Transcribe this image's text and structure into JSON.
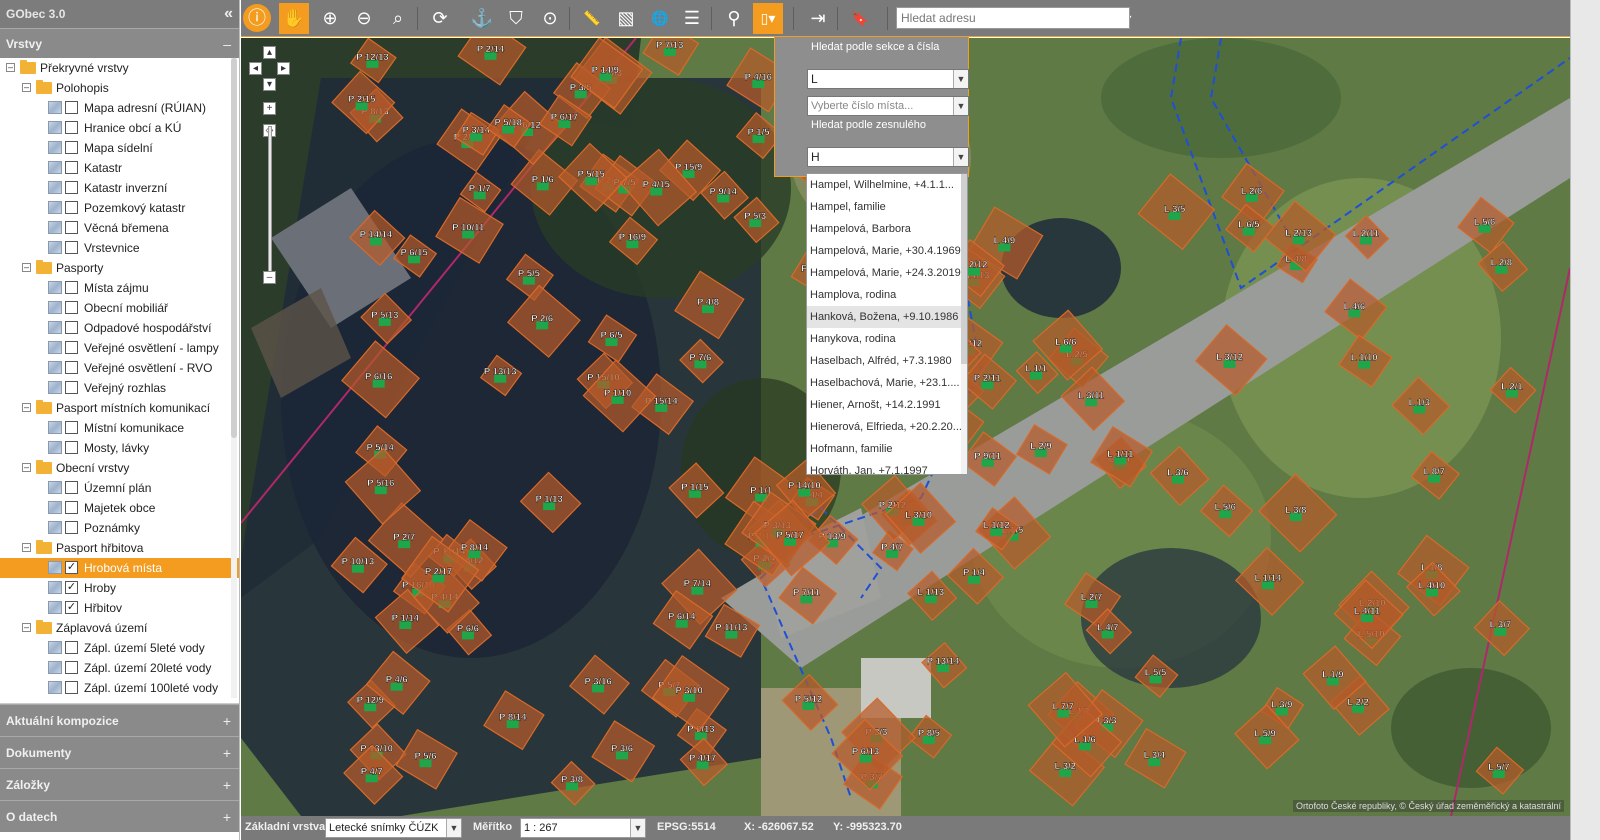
{
  "app": {
    "title": "GObec 3.0",
    "collapse_glyph": "«"
  },
  "sidebar": {
    "layers_heading": "Vrstvy",
    "layers_toggle": "–",
    "tree": [
      {
        "level": 0,
        "type": "folder",
        "expander": "–",
        "label": "Překryvné vrstvy"
      },
      {
        "level": 1,
        "type": "folder",
        "expander": "–",
        "label": "Polohopis"
      },
      {
        "level": 2,
        "type": "layer",
        "checked": false,
        "label": "Mapa adresní (RÚIAN)"
      },
      {
        "level": 2,
        "type": "layer",
        "checked": false,
        "label": "Hranice obcí a KÚ"
      },
      {
        "level": 2,
        "type": "layer",
        "checked": false,
        "label": "Mapa sídelní"
      },
      {
        "level": 2,
        "type": "layer",
        "checked": false,
        "label": "Katastr"
      },
      {
        "level": 2,
        "type": "layer",
        "checked": false,
        "label": "Katastr inverzní"
      },
      {
        "level": 2,
        "type": "layer",
        "checked": false,
        "label": "Pozemkový katastr"
      },
      {
        "level": 2,
        "type": "layer",
        "checked": false,
        "label": "Věcná břemena"
      },
      {
        "level": 2,
        "type": "layer",
        "checked": false,
        "label": "Vrstevnice"
      },
      {
        "level": 1,
        "type": "folder",
        "expander": "–",
        "label": "Pasporty"
      },
      {
        "level": 2,
        "type": "layer",
        "checked": false,
        "label": "Místa zájmu"
      },
      {
        "level": 2,
        "type": "layer",
        "checked": false,
        "label": "Obecní mobiliář"
      },
      {
        "level": 2,
        "type": "layer",
        "checked": false,
        "label": "Odpadové hospodářství"
      },
      {
        "level": 2,
        "type": "layer",
        "checked": false,
        "label": "Veřejné osvětlení - lampy"
      },
      {
        "level": 2,
        "type": "layer",
        "checked": false,
        "label": "Veřejné osvětlení - RVO"
      },
      {
        "level": 2,
        "type": "layer",
        "checked": false,
        "label": "Veřejný rozhlas"
      },
      {
        "level": 1,
        "type": "folder",
        "expander": "–",
        "label": "Pasport místních komunikací"
      },
      {
        "level": 2,
        "type": "layer",
        "checked": false,
        "label": "Místní komunikace"
      },
      {
        "level": 2,
        "type": "layer",
        "checked": false,
        "label": "Mosty, lávky"
      },
      {
        "level": 1,
        "type": "folder",
        "expander": "–",
        "label": "Obecní vrstvy"
      },
      {
        "level": 2,
        "type": "layer",
        "checked": false,
        "label": "Územní plán"
      },
      {
        "level": 2,
        "type": "layer",
        "checked": false,
        "label": "Majetek obce"
      },
      {
        "level": 2,
        "type": "layer",
        "checked": false,
        "label": "Poznámky"
      },
      {
        "level": 1,
        "type": "folder",
        "expander": "–",
        "label": "Pasport hřbitova"
      },
      {
        "level": 2,
        "type": "layer",
        "checked": true,
        "selected": true,
        "label": "Hrobová místa"
      },
      {
        "level": 2,
        "type": "layer",
        "checked": true,
        "label": "Hroby"
      },
      {
        "level": 2,
        "type": "layer",
        "checked": true,
        "label": "Hřbitov"
      },
      {
        "level": 1,
        "type": "folder",
        "expander": "–",
        "label": "Záplavová území"
      },
      {
        "level": 2,
        "type": "layer",
        "checked": false,
        "label": "Zápl. území 5leté vody"
      },
      {
        "level": 2,
        "type": "layer",
        "checked": false,
        "label": "Zápl. území 20leté vody"
      },
      {
        "level": 2,
        "type": "layer",
        "checked": false,
        "label": "Zápl. území 100leté vody"
      }
    ],
    "bottom_panels": [
      {
        "label": "Aktuální kompozice",
        "toggle": "+"
      },
      {
        "label": "Dokumenty",
        "toggle": "+"
      },
      {
        "label": "Záložky",
        "toggle": "+"
      },
      {
        "label": "O datech",
        "toggle": "+"
      }
    ]
  },
  "toolbar": {
    "buttons": [
      {
        "name": "info-icon",
        "glyph": "ⓘ",
        "active": true
      },
      {
        "name": "pan-hand-icon",
        "glyph": "✋",
        "active": true
      },
      {
        "name": "zoom-in-icon",
        "glyph": "⊕",
        "active": false
      },
      {
        "name": "zoom-out-icon",
        "glyph": "⊖",
        "active": false
      },
      {
        "name": "zoom-select-icon",
        "glyph": "⌕",
        "active": false
      },
      {
        "name": "refresh-icon",
        "glyph": "⟳",
        "active": false
      },
      {
        "name": "anchor-icon",
        "glyph": "⚓",
        "active": false
      },
      {
        "name": "person-location-icon",
        "glyph": "⛉",
        "active": false
      },
      {
        "name": "crosshair-icon",
        "glyph": "⊙",
        "active": false
      },
      {
        "name": "ruler-icon",
        "glyph": "📏",
        "active": false
      },
      {
        "name": "area-measure-icon",
        "glyph": "▧",
        "active": false
      },
      {
        "name": "globe-icon",
        "glyph": "🌐",
        "active": false
      },
      {
        "name": "list-icon",
        "glyph": "☰",
        "active": false
      },
      {
        "name": "people-search-icon",
        "glyph": "⚲",
        "active": false
      },
      {
        "name": "grave-search-icon",
        "glyph": "▯▾",
        "active": true
      },
      {
        "name": "goto-icon",
        "glyph": "⇥",
        "active": false
      },
      {
        "name": "bookmark-icon",
        "glyph": "🔖",
        "active": false
      },
      {
        "name": "help-icon",
        "glyph": "?▾",
        "active": false
      }
    ],
    "address_placeholder": "Hledat adresu"
  },
  "search_panel": {
    "section_title": "Hledat podle sekce a čísla",
    "section_value": "L",
    "place_placeholder": "Vyberte číslo místa...",
    "deceased_title": "Hledat podle zesnulého",
    "deceased_value": "H",
    "results": [
      "Hampel, Wilhelmine, +4.1.1...",
      "Hampel, familie",
      "Hampelová, Barbora",
      "Hampelová, Marie, +30.4.1969",
      "Hampelová, Marie, +24.3.2019",
      "Hamplova, rodina",
      "Hanková, Božena, +9.10.1986",
      "Hanykova, rodina",
      "Haselbach, Alfréd, +7.3.1980",
      "Haselbachová, Marie, +23.1....",
      "Hiener, Arnošt, +14.2.1991",
      "Hienerová, Elfrieda, +20.2.20...",
      "Hofmann, familie",
      "Horváth, Jan, +7.1.1997"
    ],
    "hover_index": 6
  },
  "map": {
    "attribution": "Ortofoto České republiky, © Český úřad zeměměřický a katastrální",
    "parcels": [
      "P 8/5",
      "P 5/4",
      "P 5/3",
      "P 2/1",
      "P 16/10",
      "P 12/9",
      "P 7/5",
      "P 4/4",
      "P 4/3",
      "P 1/1",
      "P 15/10",
      "P 6/5",
      "P 3/4",
      "P 3/3",
      "P 14/10",
      "P 5/5",
      "P 2/4",
      "P 14/13",
      "P 13/10",
      "P 7/6",
      "P 2/3",
      "P 11/7",
      "P 6/6",
      "P 4/7",
      "P 1/3",
      "P 13/13",
      "P 10/11",
      "P 5/6",
      "P 3/5",
      "P 1/4",
      "L 1/2",
      "L 1/1",
      "P 12/13",
      "P 9/11",
      "P 5/7",
      "P 4/6",
      "P 2/5",
      "L 1/3",
      "L 2/2",
      "P 11/13",
      "P 8/12",
      "P 7/11",
      "P 4/7",
      "P 3/6",
      "P 1/5",
      "L 3/2",
      "L 2/1",
      "P 8/12",
      "P 4/8",
      "P 2/6",
      "L 2/3",
      "L 1/4",
      "P 10/13",
      "P 8/12",
      "P 3/8",
      "P 3/7",
      "P 1/6",
      "L 1/5",
      "L3/3",
      "L 4/2",
      "P 9/13",
      "P 6/12",
      "P 13/9",
      "P 2/7",
      "L 2/5",
      "L 2/4",
      "P 15/14",
      "P 8/13",
      "P 5/12",
      "P 14/9",
      "P 1/7",
      "L 1/6",
      "P 7/13",
      "P 16/9",
      "P 15/9",
      "L 3/5",
      "L 3/4",
      "P 14/14",
      "P 13/14",
      "P 6/13",
      "P 3/10",
      "L 2/6",
      "P 8/14",
      "P 2/10",
      "L 1/7",
      "L 3/6",
      "L 4/5",
      "P 6/15",
      "P 5/13",
      "P 1/10",
      "L 2/7",
      "L 4/6",
      "L 5/5",
      "P 5/15",
      "P 11/14",
      "P 4/13",
      "P 3/12",
      "P 2/11",
      "L 3/7",
      "P 10/14",
      "P 1/11",
      "L 1/8",
      "L 4/7",
      "L 5/6",
      "L 4/4",
      "P 4/15",
      "P 9/14",
      "P 8/14",
      "P 2/12",
      "L 1/9",
      "L 2/8",
      "L 5/7",
      "L 6/5",
      "P 6/16",
      "P 3/13",
      "P 2/12",
      "L 6/7",
      "P 7/14",
      "P 2/13",
      "L 1/10",
      "L 7/7",
      "L 6/6",
      "P 3/15",
      "P 6/14",
      "L 2/10",
      "L 3/8",
      "L 5/6",
      "P 6/17",
      "P 3/14",
      "L 2/9",
      "L 4/8",
      "P 5/14",
      "L 3/10",
      "L 1/11",
      "L 8/7",
      "P 2/15",
      "P 4/14",
      "P 1/13",
      "L 4/10",
      "P 5/17",
      "P 5/16",
      "P 2/14",
      "L 3/9",
      "L 2/11",
      "L 5/10",
      "P 4/16",
      "P 1/14",
      "L 1/12",
      "P 3/16",
      "P 2/16",
      "L 5/8",
      "P 4/17",
      "L 3/11",
      "L 4/9",
      "P 3/17",
      "P 1/15",
      "L 2/12",
      "L 4/11",
      "L 1/13",
      "L 5/9",
      "P 2/17",
      "L 3/12",
      "P 5/18",
      "L 1/14",
      "L 2/13"
    ]
  },
  "statusbar": {
    "base_layer_label": "Základní vrstva",
    "base_layer_value": "Letecké snímky ČÚZK",
    "scale_label": "Měřítko",
    "scale_value": "1 : 267",
    "epsg": "EPSG:5514",
    "x_coord": "X: -626067.52",
    "y_coord": "Y: -995323.70"
  }
}
